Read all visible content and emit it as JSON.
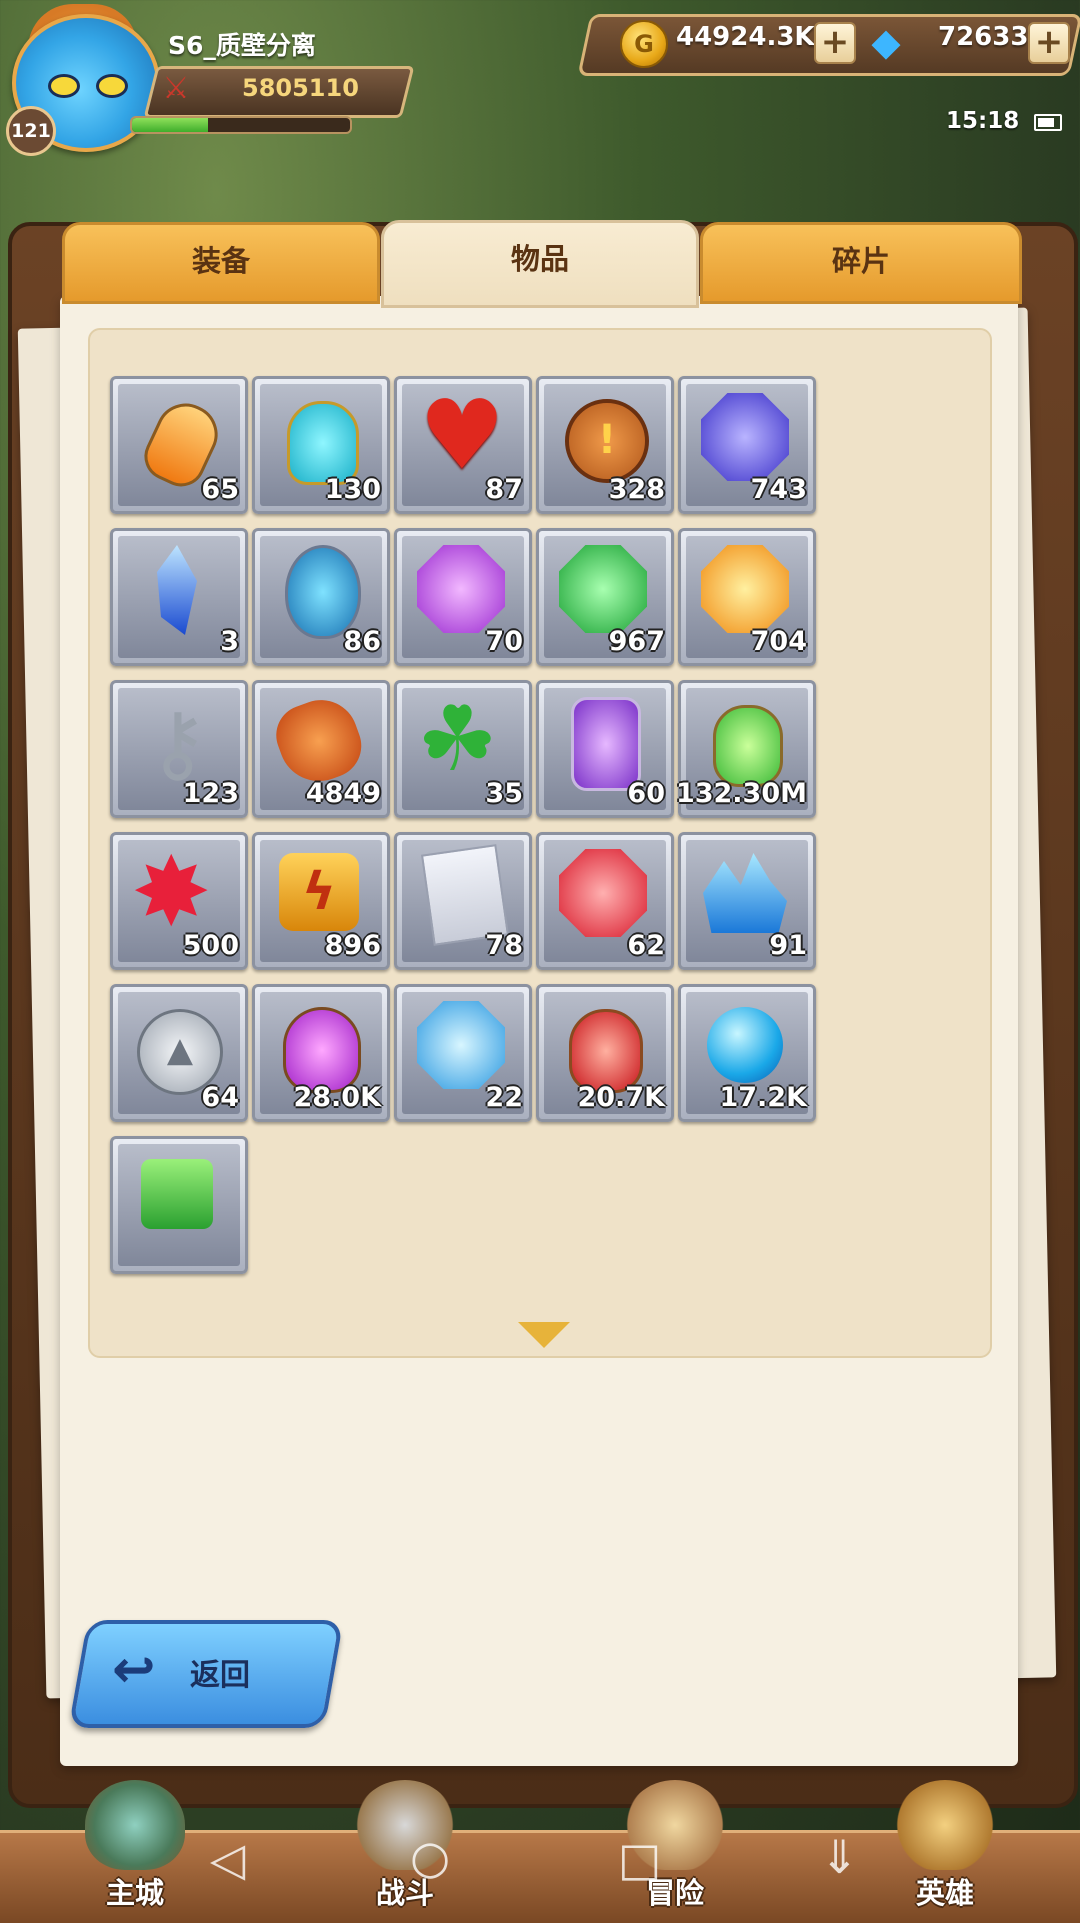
{
  "player": {
    "name": "S6_质壁分离",
    "level": "121",
    "power": "5805110",
    "xp_fraction": 0.35
  },
  "resources": {
    "gold": "44924.3K",
    "diamonds": "72633"
  },
  "status": {
    "time": "15:18"
  },
  "tabs": [
    {
      "label": "装备",
      "active": false
    },
    {
      "label": "物品",
      "active": true
    },
    {
      "label": "碎片",
      "active": false
    }
  ],
  "items": [
    {
      "icon": "orange-potion-icon",
      "qty": "65"
    },
    {
      "icon": "cyan-vase-potion-icon",
      "qty": "130"
    },
    {
      "icon": "red-heart-icon",
      "qty": "87"
    },
    {
      "icon": "bronze-sword-coin-icon",
      "qty": "328"
    },
    {
      "icon": "blue-boot-gem-icon",
      "qty": "743"
    },
    {
      "icon": "blue-crystal-shard-icon",
      "qty": "3"
    },
    {
      "icon": "blue-egg-icon",
      "qty": "86"
    },
    {
      "icon": "purple-helmet-gem-icon",
      "qty": "70"
    },
    {
      "icon": "green-glove-gem-icon",
      "qty": "967"
    },
    {
      "icon": "orange-armor-gem-icon",
      "qty": "704"
    },
    {
      "icon": "silver-key-icon",
      "qty": "123"
    },
    {
      "icon": "rune-ore-icon",
      "qty": "4849"
    },
    {
      "icon": "four-leaf-clover-icon",
      "qty": "35"
    },
    {
      "icon": "purple-crystal-jar-icon",
      "qty": "60"
    },
    {
      "icon": "green-potion-icon",
      "qty": "132.30M"
    },
    {
      "icon": "red-star-crystal-icon",
      "qty": "500"
    },
    {
      "icon": "lightning-rune-stone-icon",
      "qty": "896"
    },
    {
      "icon": "helmet-scroll-icon",
      "qty": "78"
    },
    {
      "icon": "red-sword-gem-icon",
      "qty": "62"
    },
    {
      "icon": "blue-crystal-cluster-icon",
      "qty": "91"
    },
    {
      "icon": "silver-triforce-coin-icon",
      "qty": "64"
    },
    {
      "icon": "purple-potion-icon",
      "qty": "28.0K"
    },
    {
      "icon": "blue-ring-gem-icon",
      "qty": "22"
    },
    {
      "icon": "red-potion-icon",
      "qty": "20.7K"
    },
    {
      "icon": "blue-orb-icon",
      "qty": "17.2K"
    },
    {
      "icon": "green-scroll-icon",
      "qty": ""
    }
  ],
  "back_button": {
    "label": "返回"
  },
  "nav": [
    {
      "label": "主城"
    },
    {
      "label": "战斗"
    },
    {
      "label": "冒险"
    },
    {
      "label": "英雄"
    }
  ],
  "colors": {
    "tab_active": "#f8ecd2",
    "tab_inactive": "#f1ad40",
    "back_button": "#4fa4ec",
    "nav_bar": "#a06636"
  }
}
